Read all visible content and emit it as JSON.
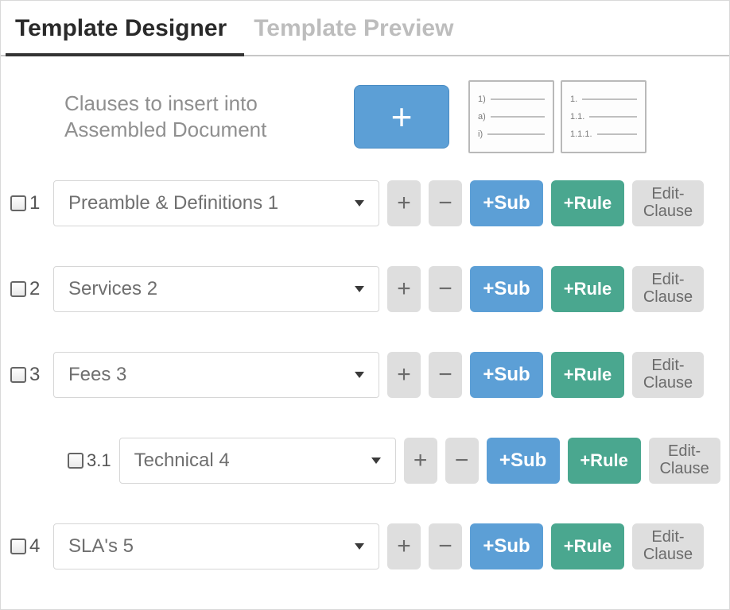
{
  "tabs": {
    "designer": "Template Designer",
    "preview": "Template Preview",
    "active": "designer"
  },
  "header": {
    "text": "Clauses to insert into Assembled Document"
  },
  "buttons": {
    "big_plus": "+",
    "plus": "+",
    "minus": "−",
    "sub": "+Sub",
    "rule": "+Rule",
    "edit": "Edit-\nClause"
  },
  "style_thumbs": [
    {
      "id": "numbered-a",
      "labels": [
        "1)",
        "a)",
        "i)"
      ]
    },
    {
      "id": "numbered-b",
      "labels": [
        "1.",
        "1.1.",
        "1.1.1."
      ]
    }
  ],
  "clauses": [
    {
      "number": "1",
      "label": "Preamble & Definitions 1",
      "indent": 0,
      "checked": false
    },
    {
      "number": "2",
      "label": "Services 2",
      "indent": 0,
      "checked": false
    },
    {
      "number": "3",
      "label": "Fees 3",
      "indent": 0,
      "checked": false
    },
    {
      "number": "3.1",
      "label": "Technical 4",
      "indent": 1,
      "checked": false
    },
    {
      "number": "4",
      "label": "SLA's 5",
      "indent": 0,
      "checked": false
    }
  ],
  "colors": {
    "accent_blue": "#5c9fd6",
    "accent_teal": "#4aa78f",
    "grey_button": "#dedede",
    "tab_active_underline": "#333333"
  }
}
